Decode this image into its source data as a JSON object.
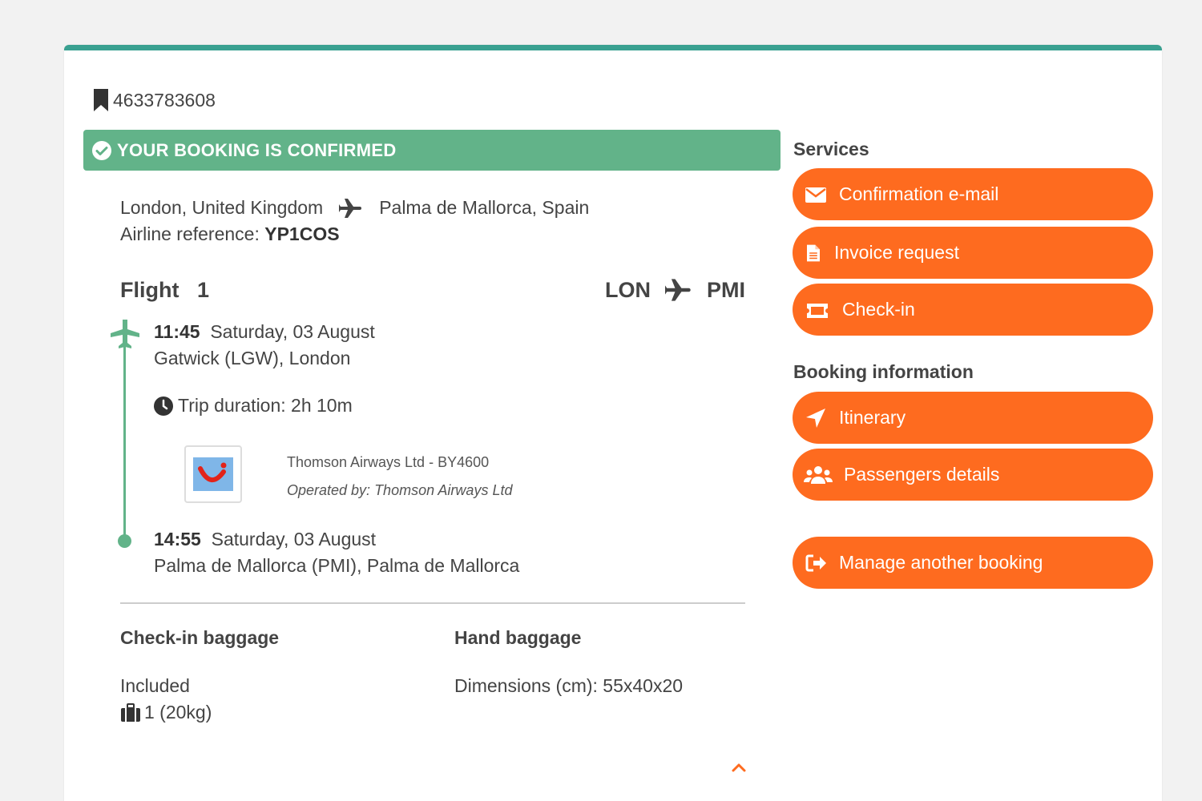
{
  "booking": {
    "id": "4633783608",
    "status_banner": "YOUR BOOKING IS CONFIRMED",
    "origin": "London, United Kingdom",
    "destination": "Palma de Mallorca, Spain",
    "airline_ref_label": "Airline reference:",
    "airline_ref": "YP1COS"
  },
  "flight": {
    "label": "Flight",
    "number": "1",
    "from_code": "LON",
    "to_code": "PMI",
    "departure": {
      "time": "11:45",
      "date": "Saturday, 03 August",
      "airport": "Gatwick (LGW), London"
    },
    "duration": "Trip duration: 2h 10m",
    "carrier": "Thomson Airways Ltd - BY4600",
    "operated_by": "Operated by: Thomson Airways Ltd",
    "arrival": {
      "time": "14:55",
      "date": "Saturday, 03 August",
      "airport": "Palma de Mallorca (PMI), Palma de Mallorca"
    }
  },
  "baggage": {
    "checkin_title": "Check-in baggage",
    "checkin_value": "Included",
    "checkin_count": "1 (20kg)",
    "hand_title": "Hand baggage",
    "hand_value": "Dimensions (cm): 55x40x20"
  },
  "sidebar": {
    "services_title": "Services",
    "services": [
      {
        "label": "Confirmation e-mail",
        "icon": "envelope-icon"
      },
      {
        "label": "Invoice request",
        "icon": "document-icon"
      },
      {
        "label": "Check-in",
        "icon": "ticket-icon"
      }
    ],
    "info_title": "Booking information",
    "info": [
      {
        "label": "Itinerary",
        "icon": "location-arrow-icon"
      },
      {
        "label": "Passengers details",
        "icon": "users-icon"
      }
    ],
    "manage_label": "Manage another booking"
  },
  "colors": {
    "accent_teal": "#3aa191",
    "confirm_green": "#62b389",
    "button_orange": "#fe6b1f"
  }
}
